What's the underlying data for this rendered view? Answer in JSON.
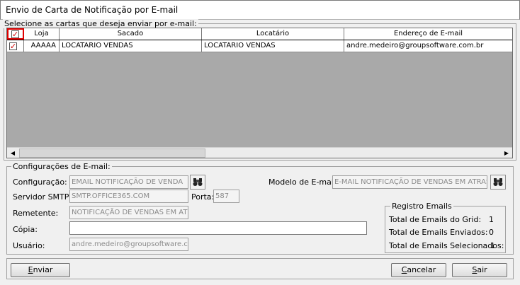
{
  "window": {
    "title": "Envio de Carta de Notificação por E-mail"
  },
  "grid_section": {
    "legend": "Selecione as cartas que deseja enviar por e-mail:",
    "columns": [
      "Loja",
      "Sacado",
      "Locatário",
      "Endereço de E-mail"
    ],
    "rows": [
      {
        "checked": true,
        "loja": "AAAAA",
        "sacado": "LOCATARIO VENDAS",
        "locatario": "LOCATARIO VENDAS",
        "email": "andre.medeiro@groupsoftware.com.br"
      }
    ]
  },
  "config": {
    "legend": "Configurações de E-mail:",
    "configuracao_label": "Configuração:",
    "configuracao_value": "EMAIL NOTIFICAÇÃO DE VENDA",
    "modelo_label": "Modelo de E-mail:",
    "modelo_value": "E-MAIL NOTIFICAÇÃO DE VENDAS EM ATRAS",
    "servidor_label": "Servidor SMTP:",
    "servidor_value": "SMTP.OFFICE365.COM",
    "porta_label": "Porta:",
    "porta_value": "587",
    "remetente_label": "Remetente:",
    "remetente_value": "NOTIFICAÇÃO DE VENDAS EM ATR",
    "copia_label": "Cópia:",
    "copia_value": "",
    "usuario_label": "Usuário:",
    "usuario_value": "andre.medeiro@groupsoftware.co"
  },
  "registro": {
    "legend": "Registro Emails",
    "total_grid_label": "Total de Emails do Grid:",
    "total_grid_value": "1",
    "total_enviados_label": "Total de Emails Enviados:",
    "total_enviados_value": "0",
    "total_selecionados_label": "Total de Emails Selecionados:",
    "total_selecionados_value": "1"
  },
  "buttons": {
    "enviar_underlined": "E",
    "enviar_rest": "nviar",
    "cancelar_underlined": "C",
    "cancelar_rest": "ancelar",
    "sair_underlined": "S",
    "sair_rest": "air"
  },
  "icons": {
    "binoculars": "binoculars-icon",
    "scroll_left": "arrow-left-icon",
    "scroll_right": "arrow-right-icon",
    "check": "checkmark-icon"
  },
  "colors": {
    "window_bg": "#f0f0f0",
    "grid_bg": "#a9a9a9",
    "highlight": "#e00000"
  }
}
